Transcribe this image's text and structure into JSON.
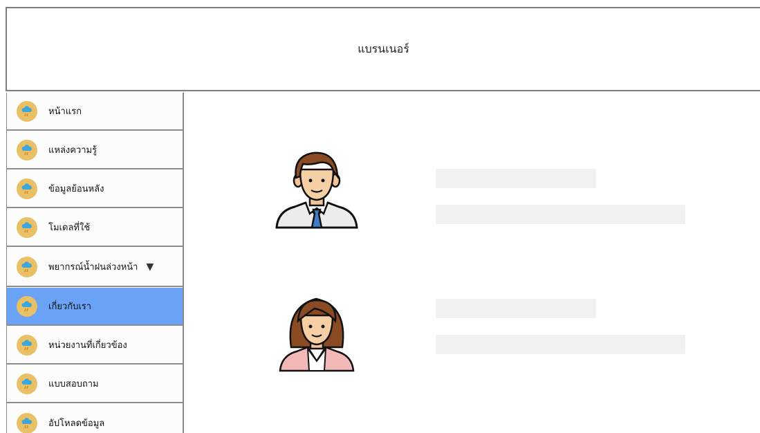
{
  "banner": {
    "title": "แบรนเนอร์"
  },
  "sidebar": {
    "items": [
      {
        "label": "หน้าแรก",
        "icon": "rain-cloud-icon"
      },
      {
        "label": "แหล่งความรู้",
        "icon": "rain-cloud-icon"
      },
      {
        "label": "ข้อมูลย้อนหลัง",
        "icon": "rain-cloud-icon"
      },
      {
        "label": "โมเดลที่ใช้",
        "icon": "rain-cloud-icon"
      },
      {
        "label": "พยากรณ์น้ำฝนล่วงหน้า",
        "icon": "rain-cloud-icon",
        "caret": "▼"
      },
      {
        "label": "เกี่ยวกับเรา",
        "icon": "rain-cloud-icon",
        "active": true
      },
      {
        "label": "หน่วยงานที่เกี่ยวข้อง",
        "icon": "rain-cloud-icon"
      },
      {
        "label": "แบบสอบถาม",
        "icon": "rain-cloud-icon"
      },
      {
        "label": "อัปโหลดข้อมูล",
        "icon": "rain-cloud-icon"
      }
    ]
  },
  "members": [
    {
      "avatar": "male-avatar-icon"
    },
    {
      "avatar": "female-avatar-icon"
    }
  ],
  "colors": {
    "active": "#6aa2f5",
    "icon_bg": "#e9c065",
    "placeholder": "#f1f1f1"
  }
}
